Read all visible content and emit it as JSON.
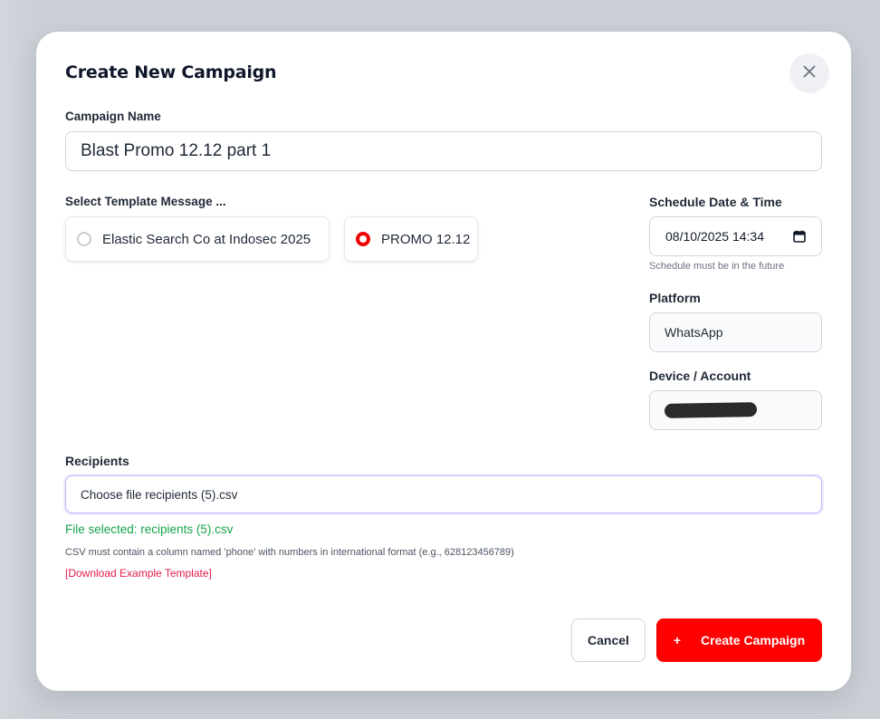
{
  "modal": {
    "title": "Create New Campaign",
    "close_icon": "close-icon"
  },
  "campaign_name": {
    "label": "Campaign Name",
    "value": "Blast Promo 12.12 part 1"
  },
  "template": {
    "label": "Select Template Message ...",
    "options": [
      {
        "label": "Elastic Search Co at Indosec 2025",
        "selected": false
      },
      {
        "label": "PROMO 12.12",
        "selected": true
      }
    ]
  },
  "schedule": {
    "label": "Schedule Date & Time",
    "value": "08/10/2025 14:34",
    "hint": "Schedule must be in the future",
    "icon": "calendar-icon"
  },
  "platform": {
    "label": "Platform",
    "value": "WhatsApp"
  },
  "device": {
    "label": "Device / Account",
    "value_redacted": true
  },
  "recipients": {
    "label": "Recipients",
    "file_input_text": "Choose file recipients (5).csv",
    "file_selected": "File selected: recipients (5).csv",
    "csv_hint": "CSV must contain a column named 'phone' with numbers in international format (e.g., 628123456789)",
    "download_link": "[Download Example Template]"
  },
  "actions": {
    "cancel_label": "Cancel",
    "create_label": "Create Campaign",
    "create_icon": "plus-icon"
  },
  "colors": {
    "accent": "#ff0000",
    "success": "#16a34a",
    "link": "#e11d48",
    "background": "#cbcfd6"
  }
}
